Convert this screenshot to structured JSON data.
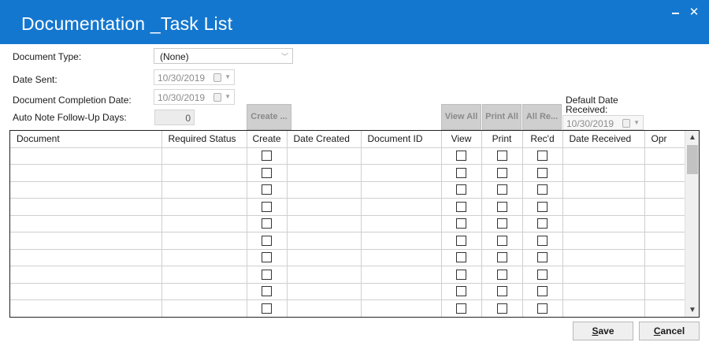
{
  "window": {
    "title": "Documentation _Task List",
    "minimize_glyph": "–",
    "close_glyph": "✕"
  },
  "form": {
    "document_type_label": "Document Type:",
    "document_type_value": "(None)",
    "date_sent_label": "Date Sent:",
    "date_sent_value": "10/30/2019",
    "completion_date_label": "Document Completion Date:",
    "completion_date_value": "10/30/2019",
    "follow_up_label": "Auto Note Follow-Up Days:",
    "follow_up_value": "0",
    "default_date_label": "Default Date Received:",
    "default_date_value": "10/30/2019"
  },
  "buttons": {
    "create": "Create ...",
    "view_all": "View All",
    "print_all": "Print All",
    "all_received": "All Re...",
    "save": "Save",
    "save_mnemonic": "S",
    "save_rest": "ave",
    "cancel": "Cancel",
    "cancel_mnemonic": "C",
    "cancel_rest": "ancel"
  },
  "grid": {
    "columns": [
      "Document",
      "Required Status",
      "Create",
      "Date Created",
      "Document ID",
      "View",
      "Print",
      "Rec'd",
      "Date Received",
      "Opr"
    ],
    "row_count_visible": 10
  },
  "icons": {
    "scroll_up": "▲",
    "scroll_down": "▼",
    "combo_arrow": "﹀",
    "date_dropdown": "▼"
  },
  "colors": {
    "titlebar": "#1477cf",
    "disabled_button": "#cfcfcf"
  }
}
